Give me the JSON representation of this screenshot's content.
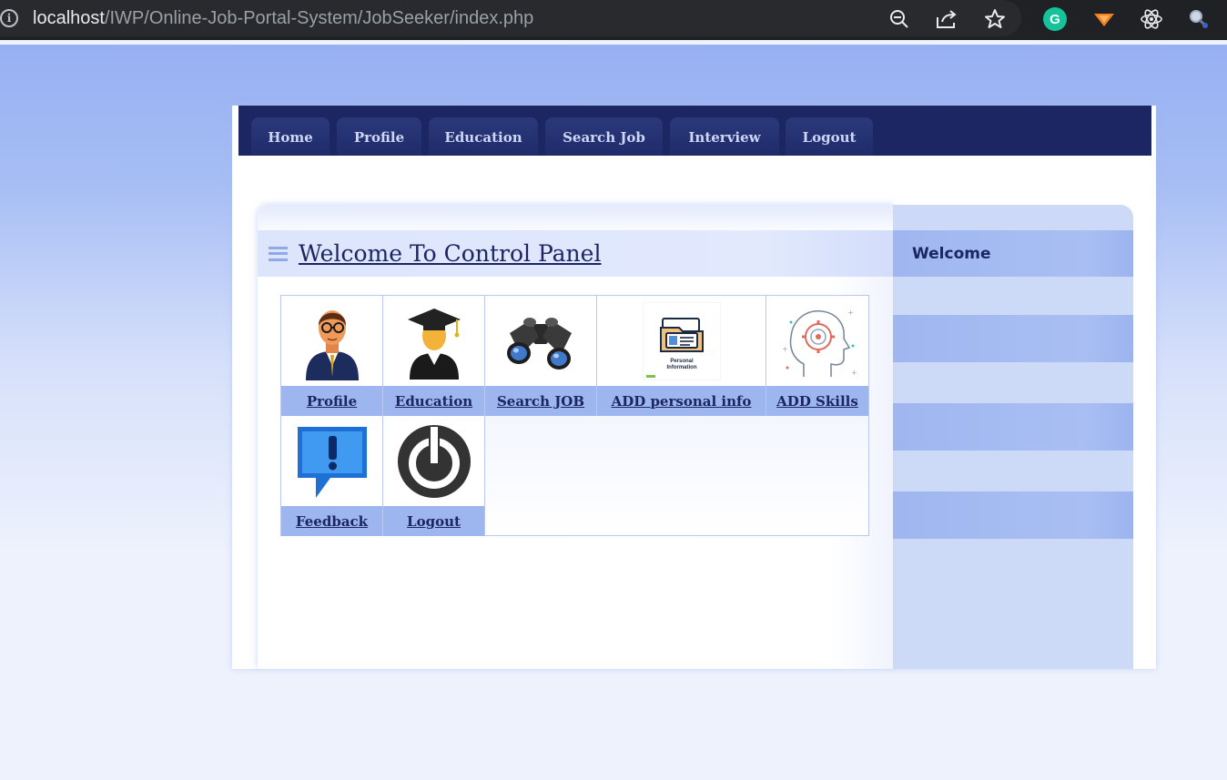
{
  "browser": {
    "url_host": "localhost",
    "url_path": "/IWP/Online-Job-Portal-System/JobSeeker/index.php",
    "info_icon": "i"
  },
  "nav": {
    "items": [
      {
        "label": "Home"
      },
      {
        "label": "Profile"
      },
      {
        "label": "Education"
      },
      {
        "label": "Search Job"
      },
      {
        "label": "Interview"
      },
      {
        "label": "Logout"
      }
    ]
  },
  "main": {
    "title": "Welcome To Control Panel"
  },
  "grid": {
    "row1": [
      {
        "label": "Profile",
        "icon": "person-icon"
      },
      {
        "label": "Education",
        "icon": "graduate-icon"
      },
      {
        "label": "Search JOB",
        "icon": "binoculars-icon"
      },
      {
        "label": "ADD personal info",
        "icon": "personal-info-icon",
        "icon_caption": "Personal Information"
      },
      {
        "label": "ADD Skills",
        "icon": "skills-head-icon"
      }
    ],
    "row2": [
      {
        "label": "Feedback",
        "icon": "feedback-icon"
      },
      {
        "label": "Logout",
        "icon": "power-icon"
      }
    ]
  },
  "sidebar": {
    "title": "Welcome"
  },
  "colors": {
    "nav_bg": "#1b2663",
    "label_bg": "#9db6ef",
    "sidebar_bg": "#ccdaf7",
    "text_dark": "#1b2663"
  }
}
